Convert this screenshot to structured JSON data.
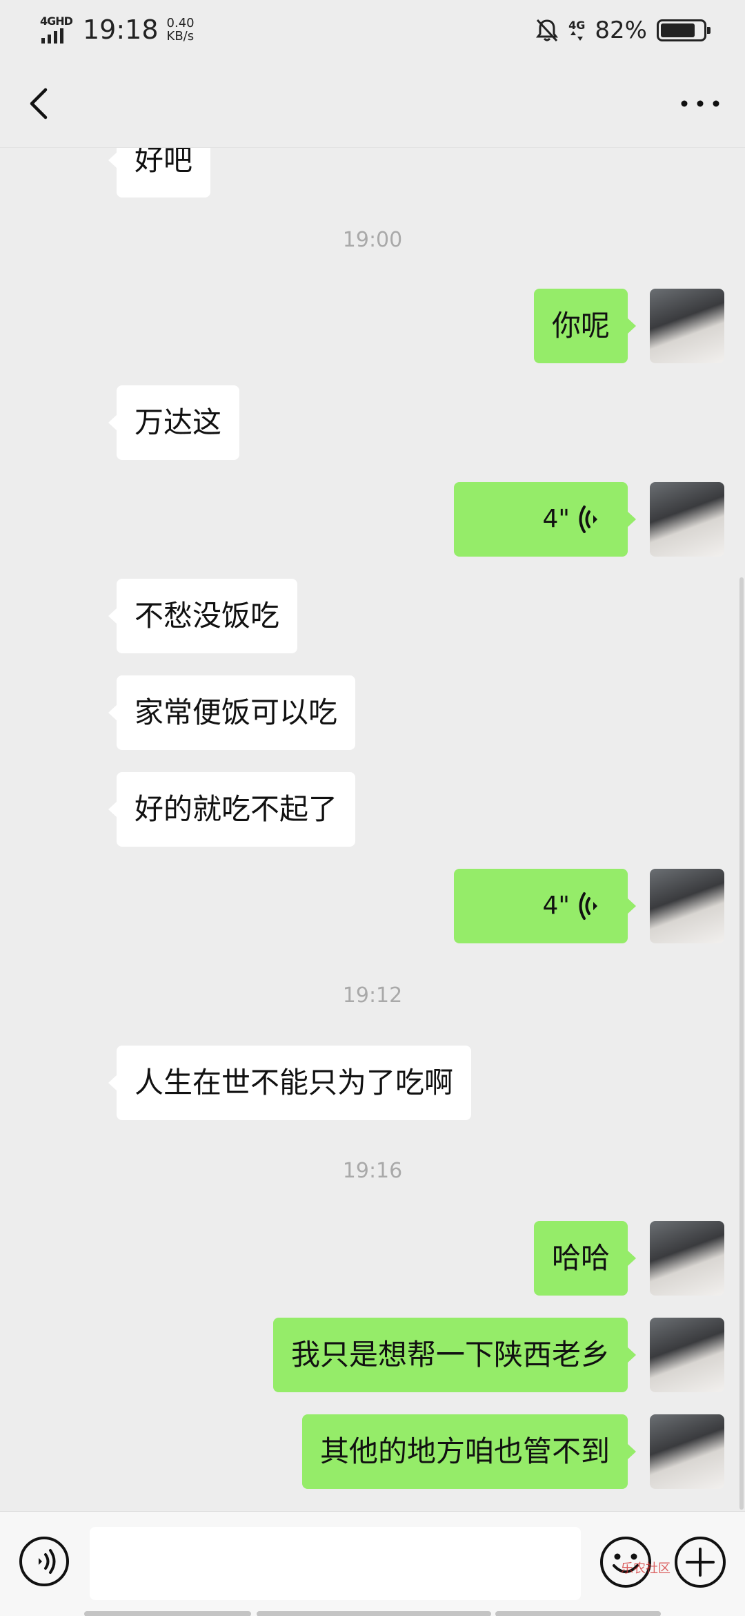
{
  "status_bar": {
    "network": "4GHD",
    "time": "19:18",
    "speed_value": "0.40",
    "speed_unit": "KB/s",
    "network_right": "4G",
    "battery_pct": "82%",
    "battery_level": 0.82
  },
  "header": {
    "back_icon": "chevron-left-icon",
    "more_icon": "more-dots-icon"
  },
  "messages": {
    "m0": "好吧",
    "ts1": "19:00",
    "m1": "你呢",
    "m2": "万达这",
    "m3_duration": "4\"",
    "m4": "不愁没饭吃",
    "m5": "家常便饭可以吃",
    "m6": "好的就吃不起了",
    "m7_duration": "4\"",
    "ts2": "19:12",
    "m8": "人生在世不能只为了吃啊",
    "ts3": "19:16",
    "m9": "哈哈",
    "m10": "我只是想帮一下陕西老乡",
    "m11": "其他的地方咱也管不到"
  },
  "input_bar": {
    "voice_icon": "voice-input-icon",
    "emoji_icon": "emoji-icon",
    "plus_icon": "plus-icon",
    "input_value": "",
    "watermark": "乐农社区"
  },
  "colors": {
    "background": "#EDEDED",
    "outgoing_bubble": "#95EC69",
    "incoming_bubble": "#FFFFFF",
    "timestamp": "#A9A9A9"
  }
}
